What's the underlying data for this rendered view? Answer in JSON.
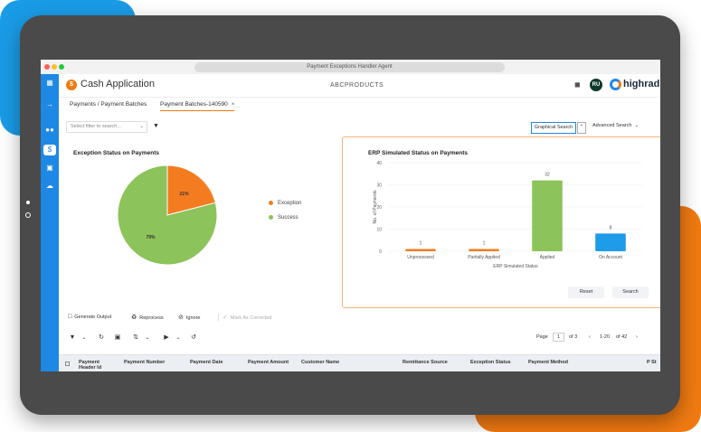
{
  "window": {
    "title": "Payment Exceptions Handler Agent"
  },
  "app": {
    "name": "Cash Application",
    "brand_center": "ABCPRODUCTS",
    "avatar_initials": "RU",
    "vendor": "highradius"
  },
  "tabs": [
    {
      "label": "Payments / Payment Batches"
    },
    {
      "label": "Payment Batches-140590",
      "close": "×"
    }
  ],
  "filter": {
    "placeholder": "Select filter to search...",
    "graphical_search": "Graphical Search",
    "advanced_search": "Advanced Search"
  },
  "colors": {
    "exception": "#f47c20",
    "success": "#8cc35a",
    "on_account": "#1e9be9",
    "accent": "#1e88e5"
  },
  "exception_chart": {
    "title": "Exception Status on Payments",
    "chart_data": {
      "type": "pie",
      "slices": [
        {
          "name": "Exception",
          "value": 21,
          "label": "21%"
        },
        {
          "name": "Success",
          "value": 79,
          "label": "79%"
        }
      ],
      "legend": [
        "Exception",
        "Success"
      ],
      "legend_position": "right"
    }
  },
  "erp_chart": {
    "title": "ERP Simulated Status on Payments",
    "chart_data": {
      "type": "bar",
      "categories": [
        "Unprocessed",
        "Partially Applied",
        "Applied",
        "On Account"
      ],
      "values": [
        1,
        1,
        32,
        8
      ],
      "xlabel": "ERP Simulated Status",
      "ylabel": "No. of Payments",
      "ylim": [
        0,
        40
      ],
      "yticks": [
        0,
        10,
        20,
        30,
        40
      ],
      "grid": true
    },
    "reset_label": "Reset",
    "search_label": "Search"
  },
  "toolbar": {
    "generate_output": "Generate Output",
    "reprocess": "Reprocess",
    "ignore": "Ignore",
    "mark_as_corrected": "Mark As Corrected"
  },
  "pager": {
    "page_label": "Page",
    "page": "1",
    "of": "of 3",
    "range": "1-20",
    "total": "of 42"
  },
  "table": {
    "columns": [
      "Payment Header Id",
      "Payment Number",
      "Payment Date",
      "Payment Amount",
      "Customer Name",
      "Remittance Source",
      "Exception Status",
      "Payment Method",
      "P St"
    ]
  }
}
